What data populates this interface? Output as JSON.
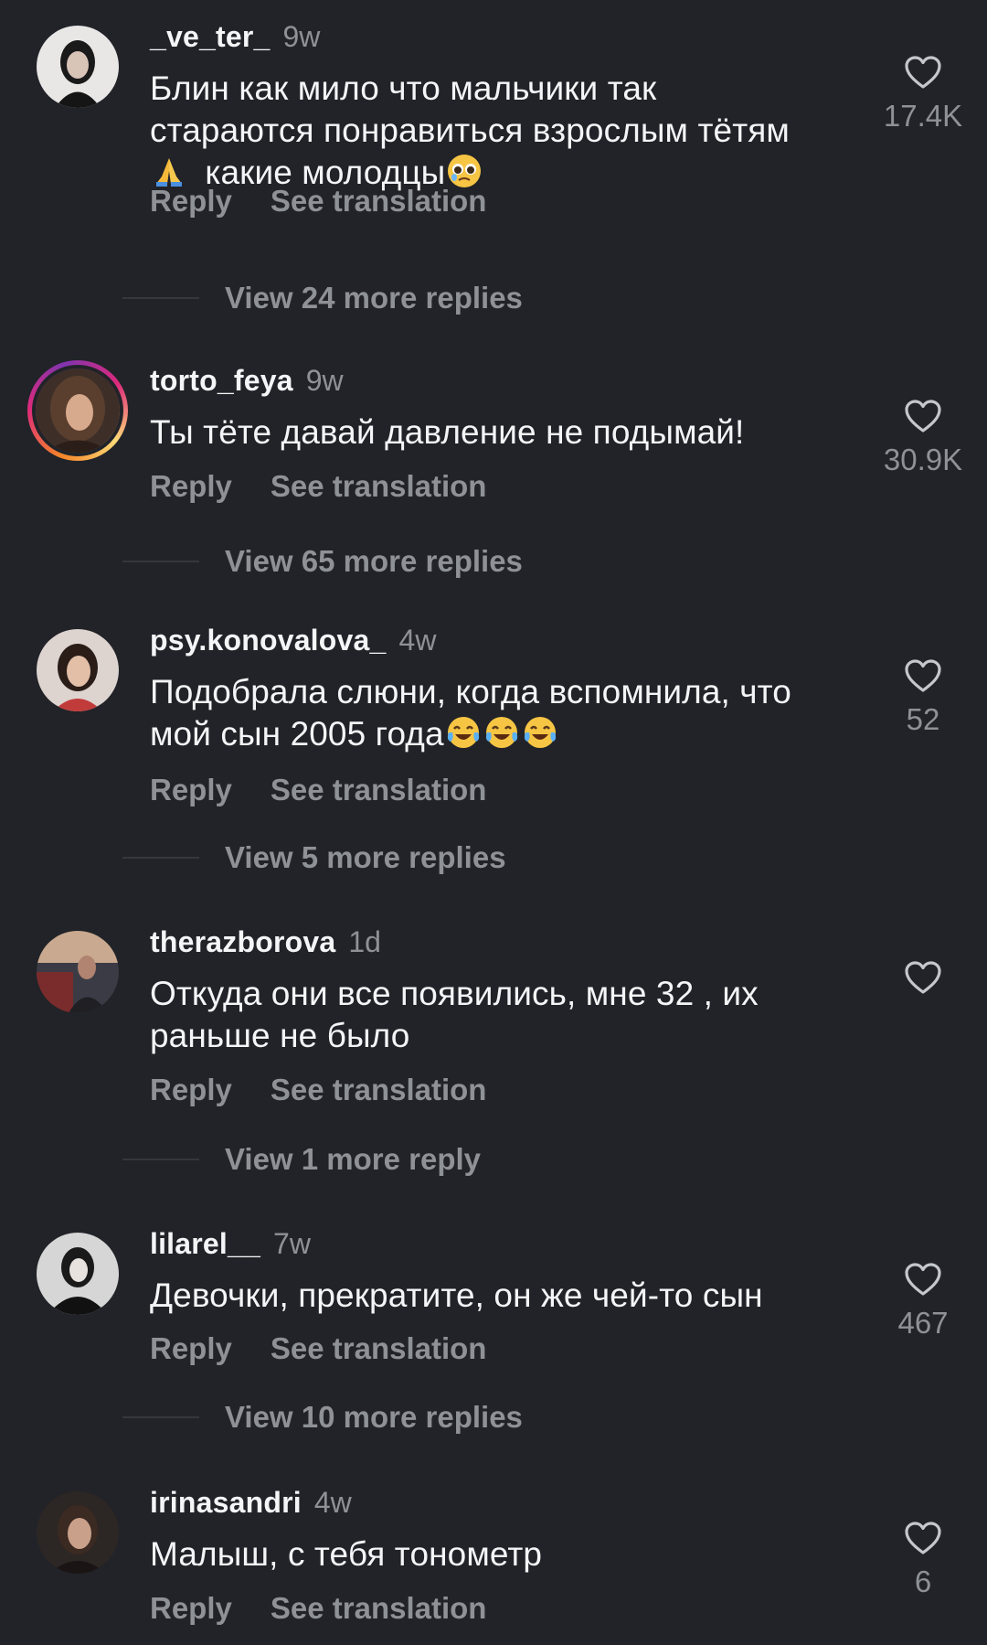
{
  "actions": {
    "reply_label": "Reply",
    "translate_label": "See translation"
  },
  "comments": [
    {
      "username": "_ve_ter_",
      "time": "9w",
      "text_lines": [
        "Блин как мило что мальчики так",
        "стараются понравиться взрослым тётям",
        "какие молодцы"
      ],
      "emojis": [
        "folded-hands",
        "pleading-face"
      ],
      "likes": "17.4K",
      "more_replies": "View 24 more replies",
      "story_ring": false
    },
    {
      "username": "torto_feya",
      "time": "9w",
      "text_lines": [
        "Ты тёте давай давление не подымай!"
      ],
      "emojis": [],
      "likes": "30.9K",
      "more_replies": "View 65 more replies",
      "story_ring": true
    },
    {
      "username": "psy.konovalova_",
      "time": "4w",
      "text_lines": [
        "Подобрала слюни, когда вспомнила, что",
        "мой сын 2005 года"
      ],
      "emojis": [
        "tears-of-joy",
        "tears-of-joy",
        "tears-of-joy"
      ],
      "likes": "52",
      "more_replies": "View 5 more replies",
      "story_ring": false
    },
    {
      "username": "therazborova",
      "time": "1d",
      "text_lines": [
        "Откуда они все появились,  мне 32 , их",
        "раньше не было"
      ],
      "emojis": [],
      "likes": "",
      "more_replies": "View 1 more reply",
      "story_ring": false
    },
    {
      "username": "lilarel__",
      "time": "7w",
      "text_lines": [
        "Девочки, прекратите, он же чей-то сын"
      ],
      "emojis": [],
      "likes": "467",
      "more_replies": "View 10 more replies",
      "story_ring": false
    },
    {
      "username": "irinasandri",
      "time": "4w",
      "text_lines": [
        "Малыш, с тебя тонометр"
      ],
      "emojis": [],
      "likes": "6",
      "more_replies": "",
      "story_ring": false
    }
  ],
  "colors": {
    "background": "#212328",
    "primary_text": "#f3f5f7",
    "secondary_text": "#8e9196"
  },
  "icons": {
    "like": "heart-outline-icon"
  }
}
